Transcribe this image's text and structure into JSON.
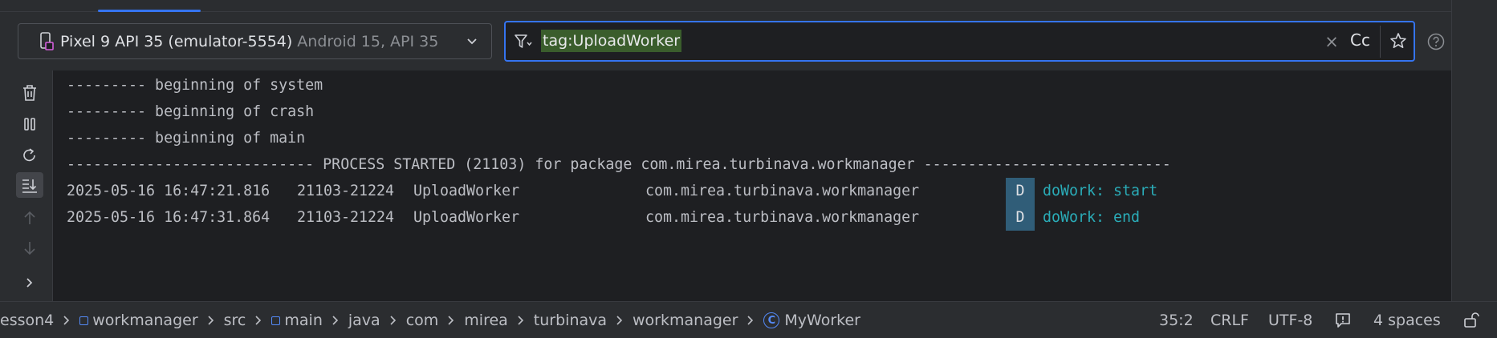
{
  "device_selector": {
    "name": "Pixel 9 API 35 (emulator-5554)",
    "meta": "Android 15, API 35"
  },
  "filter": {
    "value": "tag:UploadWorker",
    "case_button": "Cc"
  },
  "log": {
    "headers": [
      "--------- beginning of system",
      "--------- beginning of crash",
      "--------- beginning of main",
      "---------------------------- PROCESS STARTED (21103) for package com.mirea.turbinava.workmanager ----------------------------"
    ],
    "entries": [
      {
        "datetime": "2025-05-16 16:47:21.816",
        "pid": "21103-21224",
        "tag": "UploadWorker",
        "package": "com.mirea.turbinava.workmanager",
        "level": "D",
        "message": "doWork: start"
      },
      {
        "datetime": "2025-05-16 16:47:31.864",
        "pid": "21103-21224",
        "tag": "UploadWorker",
        "package": "com.mirea.turbinava.workmanager",
        "level": "D",
        "message": "doWork: end"
      }
    ]
  },
  "breadcrumbs": [
    "esson4",
    "workmanager",
    "src",
    "main",
    "java",
    "com",
    "mirea",
    "turbinava",
    "workmanager",
    "MyWorker"
  ],
  "status": {
    "position": "35:2",
    "line_ending": "CRLF",
    "encoding": "UTF-8",
    "indent": "4 spaces"
  },
  "colors": {
    "accent": "#3574f0",
    "filter_highlight": "#3a5d2c",
    "level_badge": "#305d78",
    "message_text": "#2aacb8"
  },
  "icons": [
    "phone-icon",
    "chevron-down-icon",
    "filter-icon",
    "close-icon",
    "star-icon",
    "help-icon",
    "trash-icon",
    "pause-icon",
    "restart-icon",
    "scroll-to-end-icon",
    "arrow-up-icon",
    "arrow-down-icon",
    "chevron-right-icon",
    "module-icon",
    "class-icon",
    "notification-icon",
    "lock-icon"
  ]
}
